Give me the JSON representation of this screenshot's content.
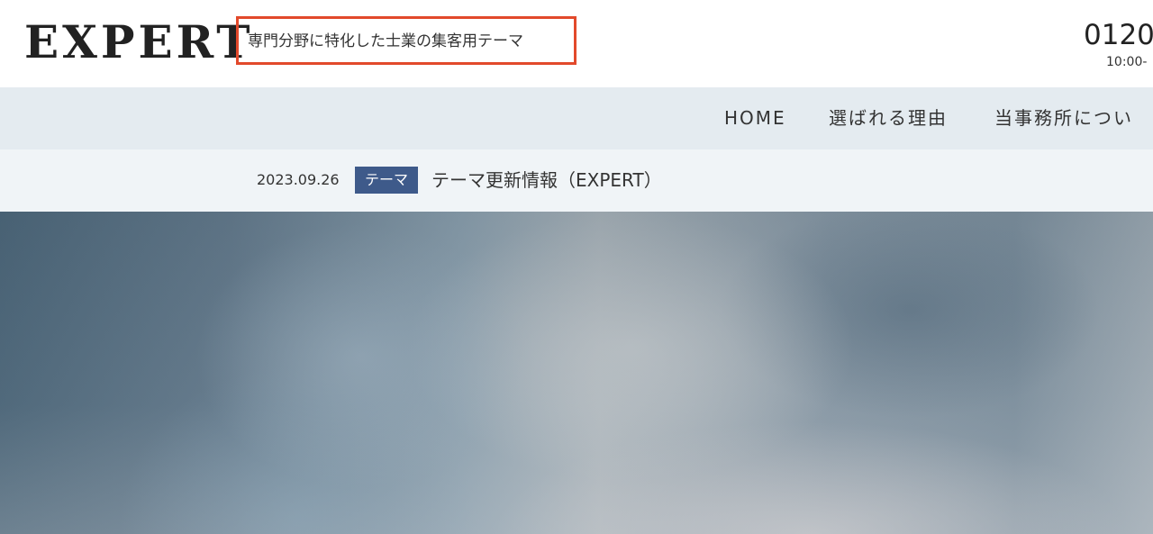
{
  "header": {
    "logo": "EXPERT",
    "tagline": "専門分野に特化した士業の集客用テーマ",
    "phone": "0120",
    "hours": "10:00-"
  },
  "nav": {
    "items": [
      {
        "label": "HOME"
      },
      {
        "label": "選ばれる理由"
      },
      {
        "label": "当事務所につい"
      }
    ]
  },
  "news": {
    "date": "2023.09.26",
    "category": "テーマ",
    "title": "テーマ更新情報（EXPERT）"
  },
  "colors": {
    "tagline_highlight_border": "#e2492b",
    "nav_background": "#e4ebf0",
    "news_background": "#f0f4f7",
    "badge_background": "#3e5a8a"
  }
}
